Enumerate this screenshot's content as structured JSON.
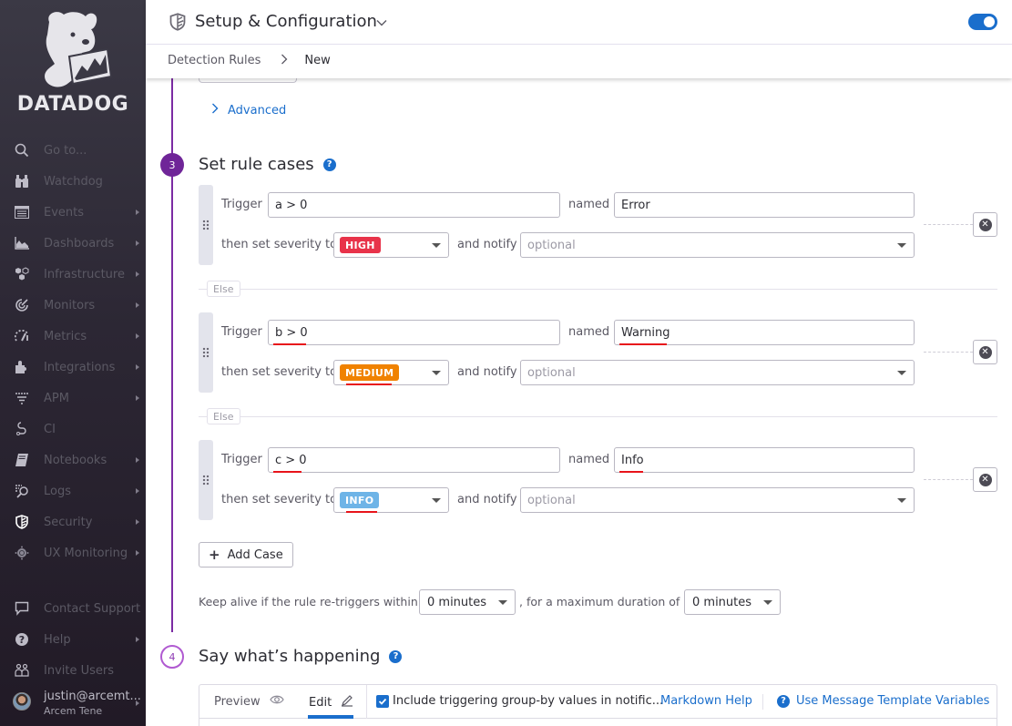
{
  "app": {
    "brand": "DATADOG",
    "accent": "#1a6ecc",
    "step_color": "#7b2ba3"
  },
  "sidebar": {
    "items": [
      {
        "label": "Go to...",
        "icon": "search-icon",
        "submenu": false
      },
      {
        "label": "Watchdog",
        "icon": "binoculars-icon",
        "submenu": false
      },
      {
        "label": "Events",
        "icon": "events-icon",
        "submenu": true
      },
      {
        "label": "Dashboards",
        "icon": "dashboards-icon",
        "submenu": true
      },
      {
        "label": "Infrastructure",
        "icon": "infrastructure-icon",
        "submenu": true
      },
      {
        "label": "Monitors",
        "icon": "monitors-icon",
        "submenu": true
      },
      {
        "label": "Metrics",
        "icon": "metrics-icon",
        "submenu": true
      },
      {
        "label": "Integrations",
        "icon": "puzzle-icon",
        "submenu": true
      },
      {
        "label": "APM",
        "icon": "apm-icon",
        "submenu": true
      },
      {
        "label": "CI",
        "icon": "ci-icon",
        "submenu": false
      },
      {
        "label": "Notebooks",
        "icon": "notebook-icon",
        "submenu": true
      },
      {
        "label": "Logs",
        "icon": "logs-icon",
        "submenu": true
      },
      {
        "label": "Security",
        "icon": "shield-icon",
        "submenu": true,
        "active": true
      },
      {
        "label": "UX Monitoring",
        "icon": "ux-monitoring-icon",
        "submenu": true
      }
    ],
    "bottom": [
      {
        "label": "Contact Support",
        "icon": "chat-icon",
        "submenu": false
      },
      {
        "label": "Help",
        "icon": "help-icon",
        "submenu": true
      },
      {
        "label": "Invite Users",
        "icon": "users-icon",
        "submenu": false
      }
    ],
    "user": {
      "email": "justin@arcemt...",
      "org": "Arcem Tene"
    }
  },
  "header": {
    "title": "Setup & Configuration",
    "toggle_on": true,
    "breadcrumb": {
      "parent": "Detection Rules",
      "current": "New"
    }
  },
  "main": {
    "advanced_label": "Advanced",
    "step3": {
      "number": "3",
      "title": "Set rule cases"
    },
    "labels": {
      "trigger": "Trigger",
      "named": "named",
      "severity": "then set severity to",
      "notify": "and notify",
      "else": "Else"
    },
    "cases": [
      {
        "trigger": "a > 0",
        "name": "Error",
        "severity": "HIGH",
        "severity_color": "#e8334a",
        "notify_placeholder": "optional"
      },
      {
        "trigger": "b > 0",
        "name": "Warning",
        "severity": "MEDIUM",
        "severity_color": "#f08200",
        "notify_placeholder": "optional"
      },
      {
        "trigger": "c > 0",
        "name": "Info",
        "severity": "INFO",
        "severity_color": "#6eb4e7",
        "notify_placeholder": "optional"
      }
    ],
    "add_case_label": "Add Case",
    "keep_alive": {
      "prefix": "Keep alive if the rule re-triggers within",
      "within_value": "0 minutes",
      "middle": ", for a maximum duration of",
      "max_value": "0 minutes"
    },
    "step4": {
      "number": "4",
      "title": "Say what’s happening"
    },
    "editor": {
      "preview_tab": "Preview",
      "edit_tab": "Edit",
      "include_groupby_label": "Include triggering group-by values in notific...",
      "include_groupby_checked": true,
      "markdown_help": "Markdown Help",
      "template_vars": "Use Message Template Variables"
    }
  }
}
